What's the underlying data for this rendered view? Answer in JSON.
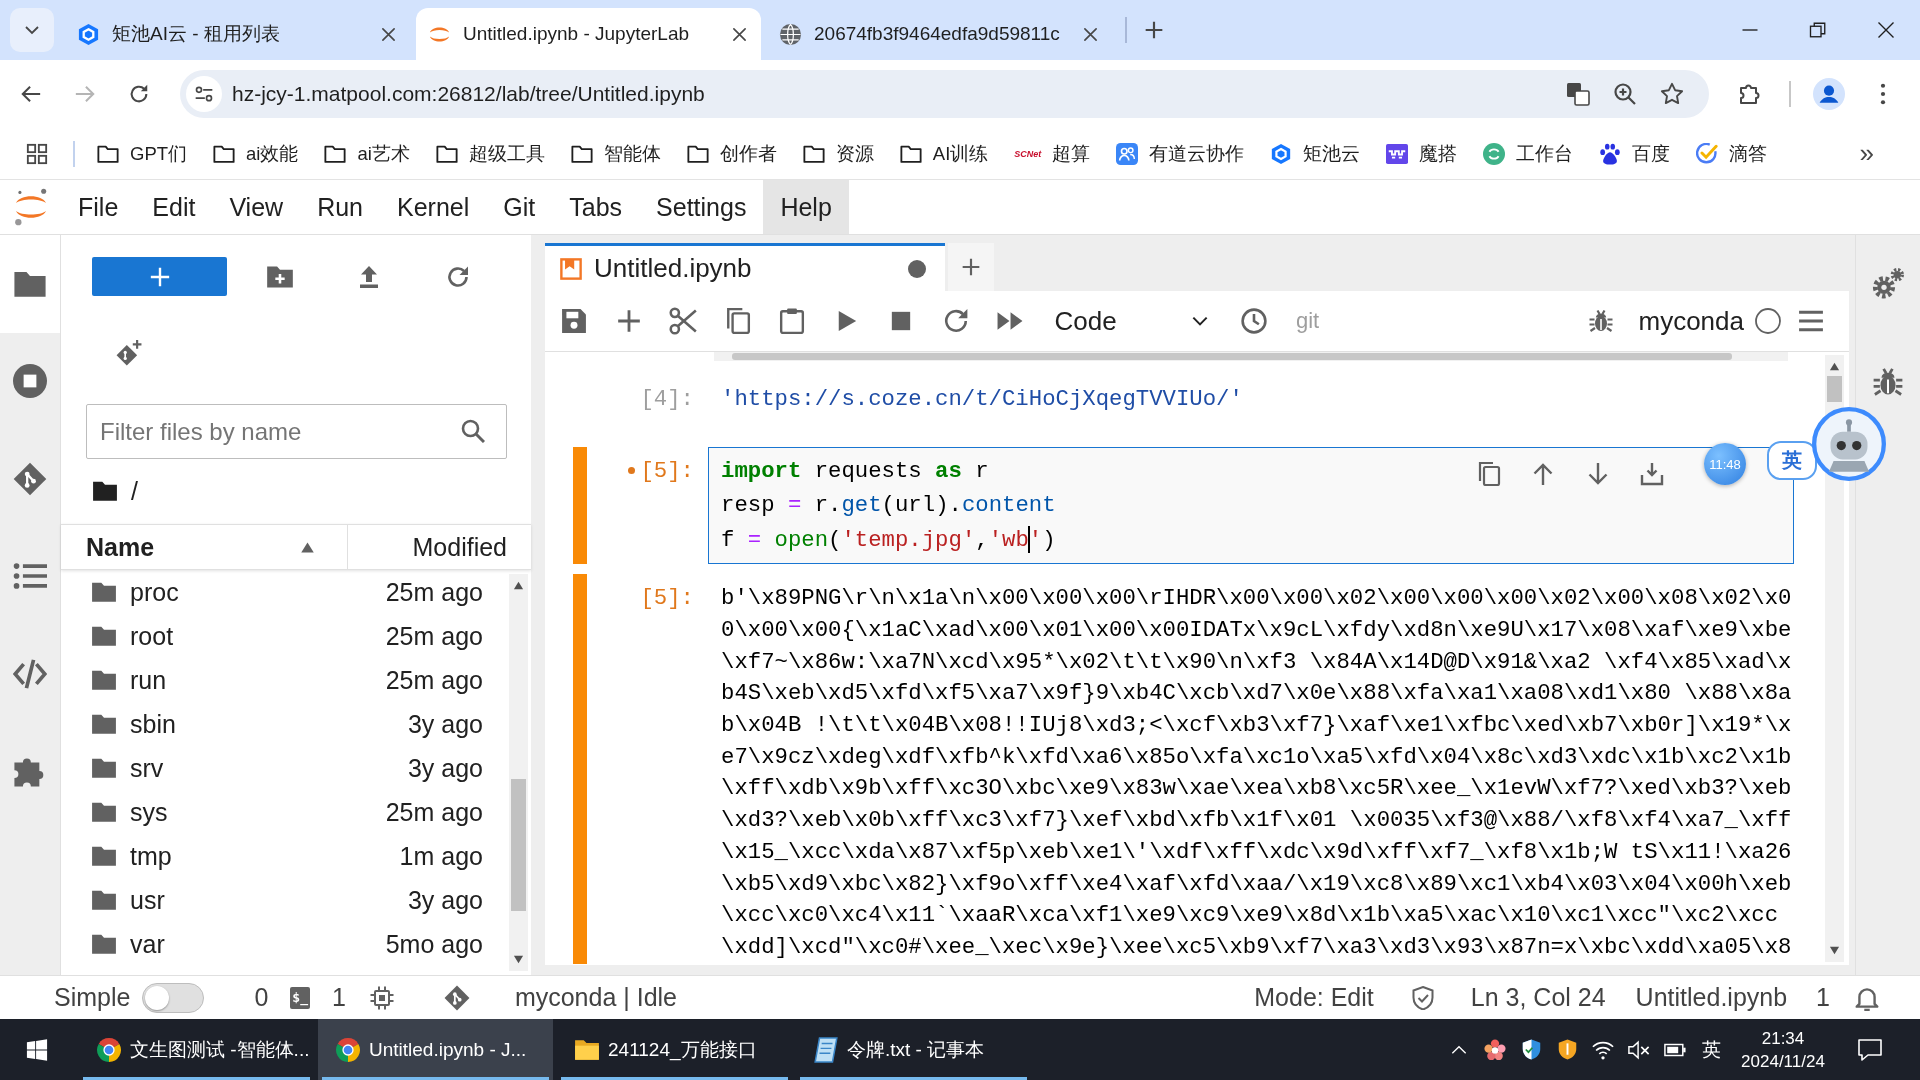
{
  "browser": {
    "tabs": [
      {
        "title": "矩池AI云 - 租用列表",
        "selected": false
      },
      {
        "title": "Untitled.ipynb - JupyterLab",
        "selected": true
      },
      {
        "title": "20674fb3f9464edfa9d59811c",
        "selected": false
      }
    ],
    "can_go_forward": false,
    "url": "hz-jcy-1.matpool.com:26812/lab/tree/Untitled.ipynb",
    "bookmarks": [
      {
        "label": "GPT们"
      },
      {
        "label": "ai效能"
      },
      {
        "label": "ai艺术"
      },
      {
        "label": "超级工具"
      },
      {
        "label": "智能体"
      },
      {
        "label": "创作者"
      },
      {
        "label": "资源"
      },
      {
        "label": "AI训练"
      },
      {
        "label": "超算",
        "logo_text": "SCNet"
      },
      {
        "label": "有道云协作"
      },
      {
        "label": "矩池云"
      },
      {
        "label": "魔搭"
      },
      {
        "label": "工作台"
      },
      {
        "label": "百度"
      },
      {
        "label": "滴答"
      }
    ],
    "bookmarks_overflow": "»"
  },
  "menu": [
    {
      "label": "File",
      "selected": false
    },
    {
      "label": "Edit",
      "selected": false
    },
    {
      "label": "View",
      "selected": false
    },
    {
      "label": "Run",
      "selected": false
    },
    {
      "label": "Kernel",
      "selected": false
    },
    {
      "label": "Git",
      "selected": false
    },
    {
      "label": "Tabs",
      "selected": false
    },
    {
      "label": "Settings",
      "selected": false
    },
    {
      "label": "Help",
      "selected": true
    }
  ],
  "left_sidebar": [
    {
      "selected": true
    },
    {
      "selected": false
    },
    {
      "selected": false
    },
    {
      "selected": false
    },
    {
      "selected": false
    },
    {
      "selected": false
    }
  ],
  "file_browser": {
    "filter_placeholder": "Filter files by name",
    "path": "/",
    "columns": [
      {
        "label": "Name",
        "sort_ascending": true
      },
      {
        "label": "Modified"
      }
    ],
    "files": [
      {
        "name": "proc",
        "modified": "25m ago",
        "selected": false
      },
      {
        "name": "root",
        "modified": "25m ago",
        "selected": false
      },
      {
        "name": "run",
        "modified": "25m ago",
        "selected": false
      },
      {
        "name": "sbin",
        "modified": "3y ago",
        "selected": false
      },
      {
        "name": "srv",
        "modified": "3y ago",
        "selected": false
      },
      {
        "name": "sys",
        "modified": "25m ago",
        "selected": false
      },
      {
        "name": "tmp",
        "modified": "1m ago",
        "selected": false
      },
      {
        "name": "usr",
        "modified": "3y ago",
        "selected": false
      },
      {
        "name": "var",
        "modified": "5mo ago",
        "selected": false
      }
    ]
  },
  "notebook": {
    "tab": {
      "title": "Untitled.ipynb",
      "unsaved": true
    },
    "cell_type": "Code",
    "git_label": "git",
    "kernel": "myconda",
    "kernel_busy": false,
    "cells": [
      {
        "selected": false,
        "output": {
          "prompt": "[4]:",
          "kind": "link",
          "lines": [
            "'https://s.coze.cn/t/CiHoCjXqegTVVIUo/'"
          ]
        }
      },
      {
        "selected": true,
        "input": {
          "prompt": "[5]:",
          "modified": true,
          "lines": [
            [
              {
                "text": "import",
                "kind": "keyword"
              },
              {
                "text": " requests ",
                "kind": "name"
              },
              {
                "text": "as",
                "kind": "keyword"
              },
              {
                "text": " r",
                "kind": "name"
              }
            ],
            [
              {
                "text": "resp ",
                "kind": "name"
              },
              {
                "text": "=",
                "kind": "operator"
              },
              {
                "text": " r.",
                "kind": "name"
              },
              {
                "text": "get",
                "kind": "property"
              },
              {
                "text": "(url).",
                "kind": "name"
              },
              {
                "text": "content",
                "kind": "property"
              }
            ],
            [
              {
                "text": "f ",
                "kind": "name"
              },
              {
                "text": "=",
                "kind": "operator"
              },
              {
                "text": " open",
                "kind": "builtin"
              },
              {
                "text": "(",
                "kind": "name"
              },
              {
                "text": "'temp.jpg'",
                "kind": "string"
              },
              {
                "text": ",",
                "kind": "name"
              },
              {
                "text": "'wb",
                "kind": "string"
              },
              {
                "kind": "cursor"
              },
              {
                "text": "'",
                "kind": "string"
              },
              {
                "text": ")",
                "kind": "name"
              }
            ]
          ]
        },
        "output": {
          "prompt": "[5]:",
          "kind": "text",
          "lines": [
            "b'\\x89PNG\\r\\n\\x1a\\n\\x00\\x00\\x00\\rIHDR\\x00\\x00\\x02\\x00\\x00\\x00\\x02\\x00\\x08\\x02\\x0",
            "0\\x00\\x00{\\x1aC\\xad\\x00\\x01\\x00\\x00IDATx\\x9cL\\xfdy\\xd8n\\xe9U\\x17\\x08\\xaf\\xe9\\xbe",
            "\\xf7~\\x86w:\\xa7N\\xcd\\x95*\\x02\\t\\t\\x90\\n\\xf3 \\x84A\\x14D@D\\x91&\\xa2 \\xf4\\x85\\xad\\x",
            "b4S\\xeb\\xd5\\xfd\\xf5\\xa7\\x9f}9\\xb4C\\xcb\\xd7\\x0e\\x88\\xfa\\xa1\\xa08\\xd1\\x80 \\x88\\x8a",
            "b\\x04B !\\t\\t\\x04B\\x08!!IUj8\\xd3;<\\xcf\\xb3\\xf7}\\xaf\\xe1\\xfbc\\xed\\xb7\\xb0r]\\x19*\\x",
            "e7\\x9cz\\xdeg\\xdf\\xfb^k\\xfd\\xa6\\x85o\\xfa\\xc1o\\xa5\\xfd\\x04\\x8c\\xd3\\xdc\\x1b\\xc2\\x1b",
            "\\xff\\xdb\\x9b\\xff\\xc3O\\xbc\\xe9\\x83w\\xae\\xea\\xb8\\xc5R\\xee_\\x1evW\\xf7?\\xed\\xb3?\\xeb",
            "\\xd3?\\xeb\\x0b\\xff\\xc3\\xf7}\\xef\\xbd\\xfb\\x1f\\x01 \\x0035\\xf3@\\x88/\\xf8\\xf4\\xa7_\\xff",
            "\\x15_\\xcc\\xda\\x87\\xf5p\\xeb\\xe1\\'\\xdf\\xff\\xdc\\x9d\\xff\\xf7_\\xf8\\x1b;W tS\\x11!\\xa26",
            "\\xb5\\xd9\\xbc\\x82}\\xf9o\\xff\\xe4\\xaf\\xfd\\xaa/\\x19\\xc8\\x89\\xc1\\xb4\\x03\\x04\\x00h\\xeb",
            "\\xcc\\xc0\\xc4\\x11`\\xaaR\\xca\\xf1\\xe9\\xc9\\xe9\\x8d\\x1b\\xa5\\xac\\x10\\xc1\\xcc\"\\xc2\\xcc",
            "\\xdd]\\xcd\"\\xc0#\\xee_\\xec\\x9e}\\xee\\xc5\\xb9\\xf7\\xa3\\xd3\\x93\\x87n=x\\xbc\\xdd\\xa05\\x8"
          ]
        }
      }
    ]
  },
  "floating_widgets": {
    "timer": "11:48",
    "ime": "英"
  },
  "status_bar": {
    "simple_label": "Simple",
    "simple_mode": false,
    "terminals": "0",
    "terminal_icon_text": "$_",
    "kernels": "1",
    "kernel_status": "myconda | Idle",
    "mode": "Mode: Edit",
    "cursor_position": "Ln 3, Col 24",
    "file": "Untitled.ipynb",
    "notifications": "1"
  },
  "taskbar": {
    "apps": [
      {
        "label": "文生图测试 -智能体...",
        "selected": false,
        "running": true
      },
      {
        "label": "Untitled.ipynb - J...",
        "selected": true,
        "running": true
      },
      {
        "label": "241124_万能接口",
        "selected": false,
        "running": true
      },
      {
        "label": "令牌.txt - 记事本",
        "selected": false,
        "running": true
      }
    ],
    "ime": "英",
    "time": "21:34",
    "date": "2024/11/24"
  }
}
